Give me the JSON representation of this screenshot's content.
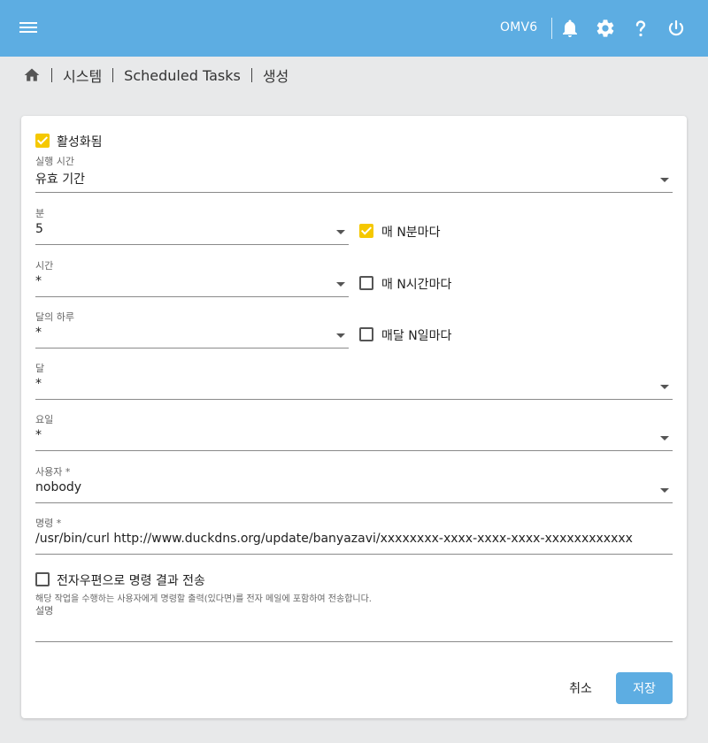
{
  "header": {
    "hostname": "OMV6",
    "icons": [
      "menu-icon",
      "bell-icon",
      "gear-icon",
      "help-icon",
      "power-icon"
    ],
    "color": "#5dade2"
  },
  "breadcrumb": {
    "items": [
      "시스템",
      "Scheduled Tasks",
      "생성"
    ]
  },
  "form": {
    "enabled": {
      "label": "활성화됨",
      "checked": true
    },
    "execution_time": {
      "label": "실행 시간",
      "value": "유효 기간"
    },
    "minute": {
      "label": "분",
      "value": "5",
      "every_label": "매 N분마다",
      "every_checked": true
    },
    "hour": {
      "label": "시간",
      "value": "*",
      "every_label": "매 N시간마다",
      "every_checked": false
    },
    "day_of_month": {
      "label": "달의 하루",
      "value": "*",
      "every_label": "매달 N일마다",
      "every_checked": false
    },
    "month": {
      "label": "달",
      "value": "*"
    },
    "day_of_week": {
      "label": "요일",
      "value": "*"
    },
    "user": {
      "label": "사용자 *",
      "value": "nobody"
    },
    "command": {
      "label": "명령 *",
      "value": "/usr/bin/curl http://www.duckdns.org/update/banyazavi/xxxxxxxx-xxxx-xxxx-xxxx-xxxxxxxxxxxx"
    },
    "send_email": {
      "label": "전자우편으로 명령 결과 전송",
      "checked": false,
      "hint": "해당 작업을 수행하는 사용자에게 명령할 출력(있다면)를 전자 메일에 포함하여 전송합니다."
    },
    "description": {
      "label": "설명",
      "value": ""
    }
  },
  "actions": {
    "cancel_label": "취소",
    "save_label": "저장"
  },
  "colors": {
    "accent": "#5dade2",
    "checkbox_checked": "#f5c800",
    "background": "#e8e9ea"
  }
}
